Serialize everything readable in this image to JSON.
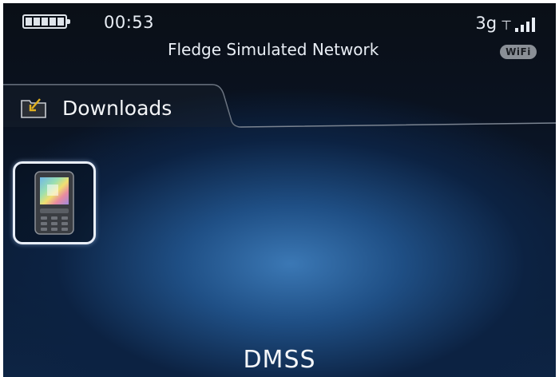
{
  "status_bar": {
    "time": "00:53",
    "network_name": "Fledge Simulated Network",
    "network_type": "3g",
    "wifi_label": "WiFi",
    "battery_icon": "battery-full-icon",
    "signal_icon": "signal-strength-icon"
  },
  "folder": {
    "title": "Downloads",
    "icon": "folder-download-icon"
  },
  "apps": [
    {
      "name": "DMSS",
      "icon": "phone-app-icon",
      "selected": true
    }
  ],
  "selected_app_label": "DMSS",
  "colors": {
    "accent_blue": "#3b78b5",
    "background_dark": "#0a0f16",
    "text": "#e9eef5",
    "selection_border": "#e8eef8",
    "folder_arrow": "#e0b020"
  }
}
